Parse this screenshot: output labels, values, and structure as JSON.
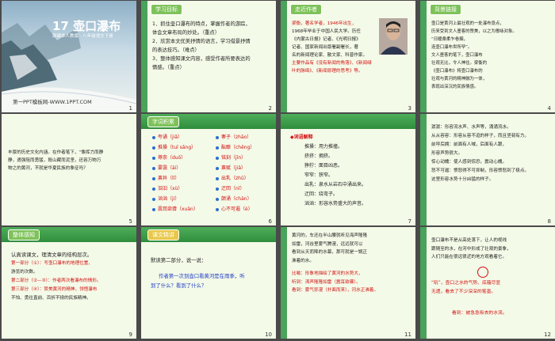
{
  "slides": [
    {
      "num": "1",
      "title": "17 壶口瀑布",
      "subtitle": "部编本人教版 · 八年级语文下册",
      "footer": "第一PPT模板网-WWW.1PPT.COM"
    },
    {
      "num": "2",
      "tag": "学习目标",
      "lines": [
        "1．抓住壶口瀑布的特点，掌握作者的游踪，",
        "体会文章布局的妙处。（重点）",
        "2．欣赏本文优美抒情的语言，学习借景抒情",
        "的表达技巧。（难点）",
        "3．整体感知课文内容，感受作者所要表达的",
        "情感。（重点）"
      ]
    },
    {
      "num": "3",
      "tag": "走近作者",
      "lines": [
        "梁衡，著名学者，1946年出生，",
        "1968年毕业于中国人民大学。历任",
        "《内蒙古日报》记者、《光明日报》",
        "记者、国家新闻出版署副署长，著",
        "名的新闻理论家、散文家、科普作家。",
        "主要作品有《没有新闻的角落》、《新闻绿",
        "叶的脉络》、《新闻原理的思考》等。"
      ]
    },
    {
      "num": "4",
      "tag": "背景链接",
      "lines": [
        "壶口是黄河上最壮观的一处瀑布景点，",
        "历来受到文人墨客的赞美，以之为歌咏对象。",
        "“日暖桑柔乍卷烟，",
        "连壶口瀑布世所罕”。",
        "文人墨客的笔下，壶口瀑布",
        "壮观无比，令人神往。梁衡的",
        "《壶口瀑布》将壶口瀑布的",
        "壮观与黄河的精神融为一体，",
        "表现出深沉的民族情感。"
      ]
    },
    {
      "num": "5",
      "lines": [
        "丰厚的历史文化内涵。在作者笔下，“像挥力而静",
        "静，遇强阻而勇猛，既山藏而泥坚，还容万物万",
        "物之的黄河，不就是华夏民族的象征吗？"
      ]
    },
    {
      "num": "6",
      "tag": "字词积累",
      "pairs": [
        [
          "夸诵（jiǎ）",
          "寨子（zhāo）"
        ],
        [
          "推搡（tuī sǎng）",
          "酝酿（chēng）"
        ],
        [
          "尊崇（duō）",
          "铭刻（jīn）"
        ],
        [
          "霎霭（āi）",
          "禀赋（jiā）"
        ],
        [
          "禀异（lǐ）",
          "出乳（zhǔ）"
        ],
        [
          "泪汩（xù）",
          "迂回（nǐ）"
        ],
        [
          "汹汹（jí）",
          "颠涌（chān）"
        ],
        [
          "震耳欲聋（xuān）",
          "心不可遏（è）"
        ]
      ]
    },
    {
      "num": "7",
      "tag": "词语解释",
      "lines": [
        "◆词语解释",
        "推搡：用力推撞。",
        "挤挤：拥挤。",
        "狰狞：面目凶恶。",
        "窄窄：狭窄。",
        "出乳：泉水从岩石中涌出来。",
        "迂回：绕弯子。",
        "汹汹：形容水势盛大的声音。"
      ]
    },
    {
      "num": "8",
      "lines": [
        "潺潺：形容流水声、水声等，涌涌流水。",
        "从从容容：形容从容不迫的样子，而且坚韧有力。",
        "前呼后拥：前面有人喊，后面有人跟，",
        "形容声势很大。",
        "惊心动魄：使人感到惊恐，震动心魄。",
        "怒不可遏：愤怒得不可抑制，形容愤怒到了极点。",
        "这里形容水势十分凶猛的样子。"
      ]
    },
    {
      "num": "9",
      "tag": "整体感知",
      "lines": [
        "认真读课文，理清文章的结构层次。",
        "第一部分（①）：写壶口瀑布的地理位置，",
        "游览的次数。",
        "第二部分（②—③）：作者两次看瀑布的情形。",
        "第三部分（④）：赞美黄河的精神，领悟瀑布",
        "不怕、勇往直前、百折不挠的民族精神。"
      ]
    },
    {
      "num": "10",
      "tag": "课文精讲",
      "lines": [
        "默读第二部分，说一说：",
        "作者第一次到壶口看黄河是在雨季，听",
        "到了什么？看到了什么？"
      ]
    },
    {
      "num": "11",
      "lines": [
        "黄河的，车还在半山腰就听见海声隆隆",
        "如雷，河谷里雾气腾漫，远远就可以",
        "看到从天而降的水幕，那可就是一锅正",
        "沸着的水。",
        "比喻：形象地描绘了黄河的水势大，",
        "听到：涛声隆隆如雷（震耳欲聋）。",
        "看到：雾气弥漫（扑面而来），河水正沸着。"
      ]
    },
    {
      "num": "12",
      "lines": [
        "壶口瀑布不是从高处落下，让人的视线",
        "跟随至的水，在河中形成了壮观的景象，",
        "人们只能在很远很近的地方观看着它。",
        "“吼”，壶口之水的气势、底蕴尽显",
        "无遗，看去了不少深深的笔墨。",
        "看到：被急急吸去的水流。"
      ]
    }
  ]
}
